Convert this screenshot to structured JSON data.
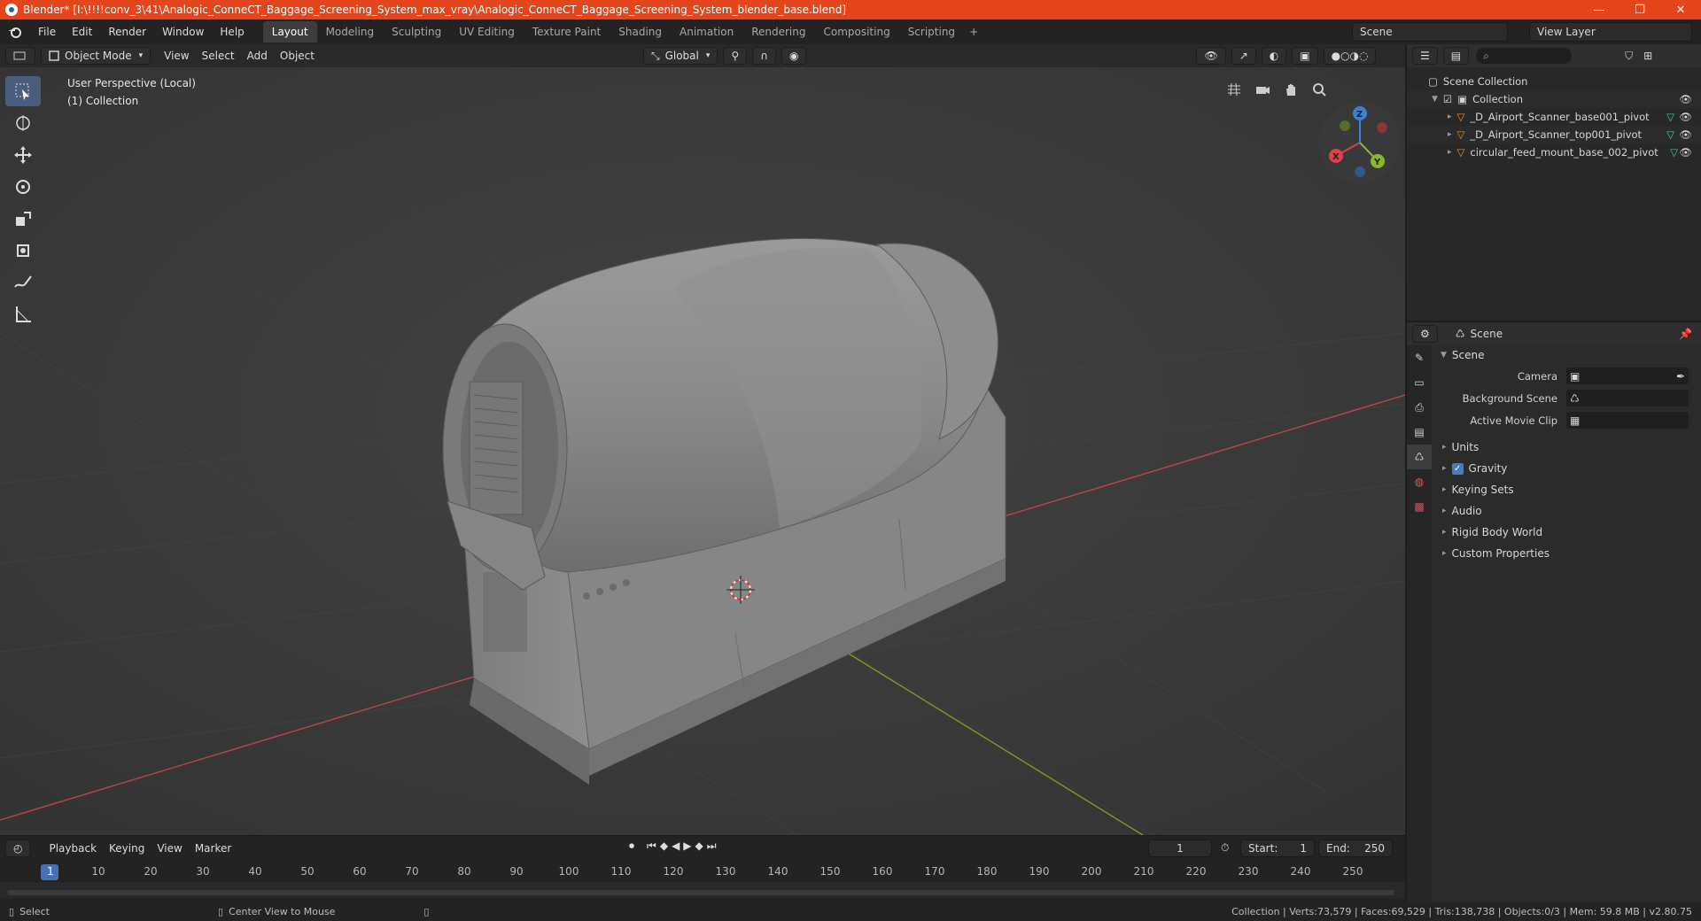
{
  "window": {
    "title": "Blender* [I:\\!!!!conv_3\\41\\Analogic_ConneCT_Baggage_Screening_System_max_vray\\Analogic_ConneCT_Baggage_Screening_System_blender_base.blend]",
    "minimize": "—",
    "maximize": "❐",
    "close": "✕"
  },
  "menubar": {
    "items": [
      "File",
      "Edit",
      "Render",
      "Window",
      "Help"
    ]
  },
  "workspaces": {
    "tabs": [
      "Layout",
      "Modeling",
      "Sculpting",
      "UV Editing",
      "Texture Paint",
      "Shading",
      "Animation",
      "Rendering",
      "Compositing",
      "Scripting"
    ],
    "active": "Layout",
    "add": "+"
  },
  "scene_selector": {
    "value": "Scene"
  },
  "viewlayer_selector": {
    "value": "View Layer"
  },
  "viewport": {
    "mode": "Object Mode",
    "menus": [
      "View",
      "Select",
      "Add",
      "Object"
    ],
    "transform_orientation": "Global",
    "info_line1": "User Perspective (Local)",
    "info_line2": "(1) Collection",
    "gizmo": {
      "x": "X",
      "y": "Y",
      "z": "Z"
    }
  },
  "timeline": {
    "menus": [
      "Playback",
      "Keying",
      "View",
      "Marker"
    ],
    "current_frame": "1",
    "start_label": "Start:",
    "start_value": "1",
    "end_label": "End:",
    "end_value": "250",
    "ruler": [
      "1",
      "10",
      "20",
      "30",
      "40",
      "50",
      "60",
      "70",
      "80",
      "90",
      "100",
      "110",
      "120",
      "130",
      "140",
      "150",
      "160",
      "170",
      "180",
      "190",
      "200",
      "210",
      "220",
      "230",
      "240",
      "250"
    ]
  },
  "statusbar": {
    "select": "Select",
    "center_view": "Center View to Mouse",
    "stats": "Collection | Verts:73,579 | Faces:69,529 | Tris:138,738 | Objects:0/3 | Mem: 59.8 MB | v2.80.75"
  },
  "outliner": {
    "root": "Scene Collection",
    "collection": "Collection",
    "objects": [
      "_D_Airport_Scanner_base001_pivot",
      "_D_Airport_Scanner_top001_pivot",
      "circular_feed_mount_base_002_pivot"
    ]
  },
  "properties": {
    "header": "Scene",
    "panel": "Scene",
    "camera_label": "Camera",
    "background_label": "Background Scene",
    "movieclip_label": "Active Movie Clip",
    "subpanels": [
      "Units",
      "Gravity",
      "Keying Sets",
      "Audio",
      "Rigid Body World",
      "Custom Properties"
    ]
  },
  "colors": {
    "title_bar": "#e4451b",
    "active_tool": "#4a5d7c",
    "x_axis": "#d9414c",
    "y_axis": "#8ab62e",
    "z_axis": "#3f7fd4"
  }
}
